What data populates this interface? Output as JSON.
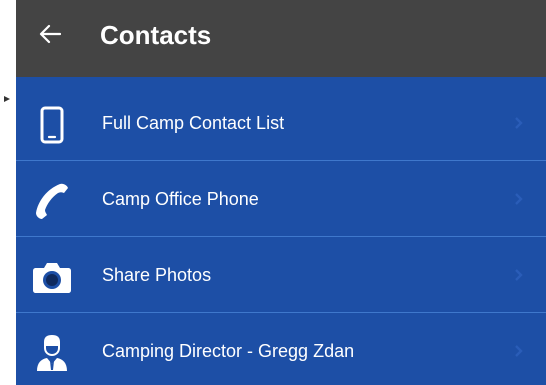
{
  "header": {
    "title": "Contacts",
    "back_icon": "arrow-left-icon"
  },
  "colors": {
    "header_bg": "#444444",
    "list_bg": "#1d4fa6",
    "divider": "#3f78cc",
    "text": "#ffffff",
    "chevron": "#2a5db8"
  },
  "contacts": {
    "items": [
      {
        "label": "Full Camp Contact List",
        "icon": "mobile-phone-icon"
      },
      {
        "label": "Camp Office Phone",
        "icon": "phone-handset-icon"
      },
      {
        "label": "Share Photos",
        "icon": "camera-icon"
      },
      {
        "label": "Camping Director - Gregg Zdan",
        "icon": "person-icon"
      }
    ],
    "chevron_icon": "chevron-right-icon"
  }
}
